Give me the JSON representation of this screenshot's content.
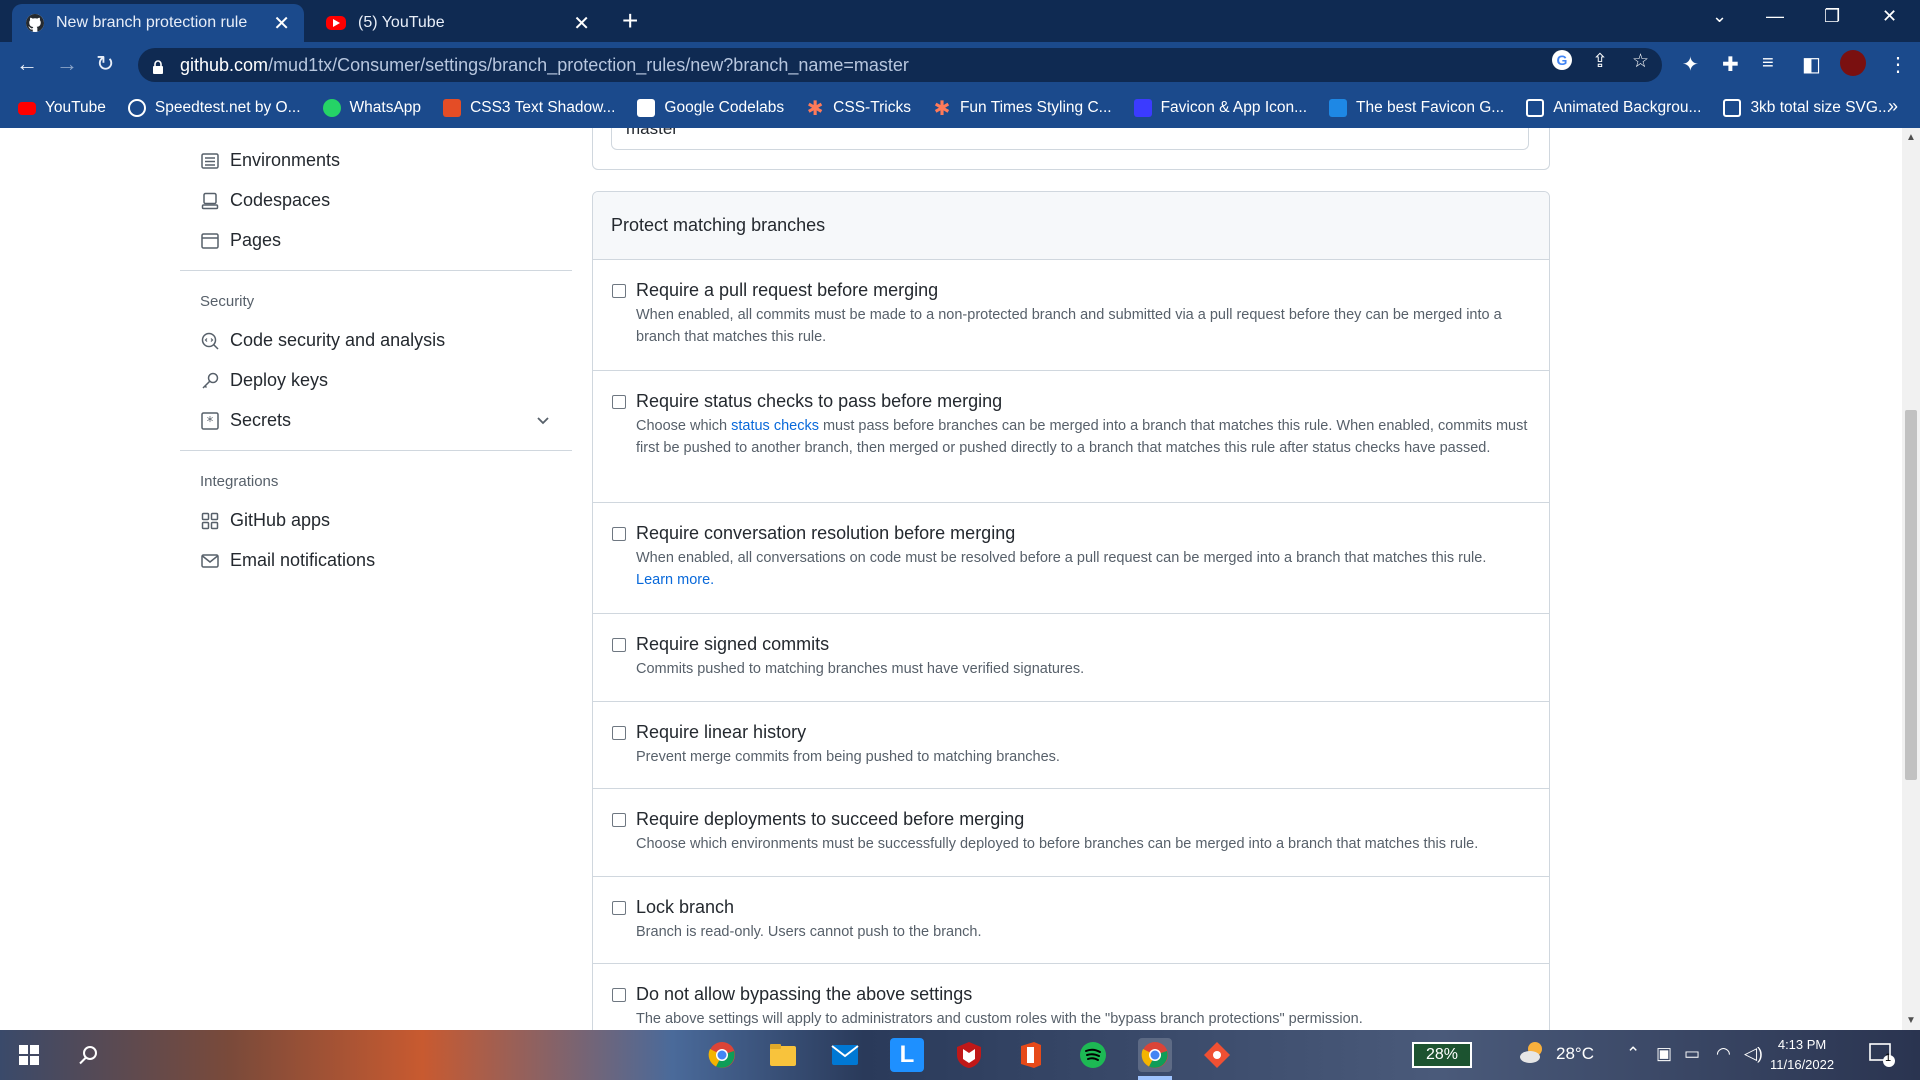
{
  "browser": {
    "tabs": [
      {
        "title": "New branch protection rule",
        "active": true
      },
      {
        "title": "(5) YouTube",
        "active": false
      }
    ],
    "url_host": "github.com",
    "url_path": "/mud1tx/Consumer/settings/branch_protection_rules/new?branch_name=master",
    "bookmarks": [
      {
        "label": "YouTube",
        "icon": "youtube-icon",
        "color": "#ff0000"
      },
      {
        "label": "Speedtest.net by O...",
        "icon": "speedtest-icon",
        "color": "#1b1b1b"
      },
      {
        "label": "WhatsApp",
        "icon": "whatsapp-icon",
        "color": "#25d366"
      },
      {
        "label": "CSS3 Text Shadow...",
        "icon": "css3-icon",
        "color": "#e44d26"
      },
      {
        "label": "Google Codelabs",
        "icon": "codelabs-icon",
        "color": "#ffffff"
      },
      {
        "label": "CSS-Tricks",
        "icon": "csstricks-icon",
        "color": "#ff7a59"
      },
      {
        "label": "Fun Times Styling C...",
        "icon": "funtimes-icon",
        "color": "#ff7a59"
      },
      {
        "label": "Favicon & App Icon...",
        "icon": "favicon-icon",
        "color": "#3b3bff"
      },
      {
        "label": "The best Favicon G...",
        "icon": "favicon-gen-icon",
        "color": "#1e88e5"
      },
      {
        "label": "Animated Backgrou...",
        "icon": "codepen-icon",
        "color": "#ffffff"
      },
      {
        "label": "3kb total size SVG...",
        "icon": "codepen-icon",
        "color": "#ffffff"
      }
    ]
  },
  "sidebar": {
    "items_top": [
      {
        "label": "Environments",
        "icon": "environments-icon"
      },
      {
        "label": "Codespaces",
        "icon": "codespaces-icon"
      },
      {
        "label": "Pages",
        "icon": "pages-icon"
      }
    ],
    "security_heading": "Security",
    "security_items": [
      {
        "label": "Code security and analysis",
        "icon": "codescan-icon"
      },
      {
        "label": "Deploy keys",
        "icon": "key-icon"
      },
      {
        "label": "Secrets",
        "icon": "secrets-icon"
      }
    ],
    "integrations_heading": "Integrations",
    "integrations_items": [
      {
        "label": "GitHub apps",
        "icon": "apps-icon"
      },
      {
        "label": "Email notifications",
        "icon": "mail-icon"
      }
    ]
  },
  "pattern_input_value": "master",
  "protect": {
    "header": "Protect matching branches",
    "rules": [
      {
        "title": "Require a pull request before merging",
        "desc": "When enabled, all commits must be made to a non-protected branch and submitted via a pull request before they can be merged into a branch that matches this rule.",
        "checked": false
      },
      {
        "title": "Require status checks to pass before merging",
        "desc_pre": "Choose which ",
        "desc_link": "status checks",
        "desc_post": " must pass before branches can be merged into a branch that matches this rule. When enabled, commits must first be pushed to another branch, then merged or pushed directly to a branch that matches this rule after status checks have passed.",
        "checked": false
      },
      {
        "title": "Require conversation resolution before merging",
        "desc": "When enabled, all conversations on code must be resolved before a pull request can be merged into a branch that matches this rule.",
        "desc_link": "Learn more.",
        "checked": false
      },
      {
        "title": "Require signed commits",
        "desc": "Commits pushed to matching branches must have verified signatures.",
        "checked": false
      },
      {
        "title": "Require linear history",
        "desc": "Prevent merge commits from being pushed to matching branches.",
        "checked": false
      },
      {
        "title": "Require deployments to succeed before merging",
        "desc": "Choose which environments must be successfully deployed to before branches can be merged into a branch that matches this rule.",
        "checked": false
      },
      {
        "title": "Lock branch",
        "desc": "Branch is read-only. Users cannot push to the branch.",
        "checked": false
      },
      {
        "title": "Do not allow bypassing the above settings",
        "desc": "The above settings will apply to administrators and custom roles with the \"bypass branch protections\" permission.",
        "checked": false
      }
    ]
  },
  "taskbar": {
    "battery": "28%",
    "weather": "28°C",
    "time": "4:13 PM",
    "date": "11/16/2022",
    "notifications": "1"
  }
}
